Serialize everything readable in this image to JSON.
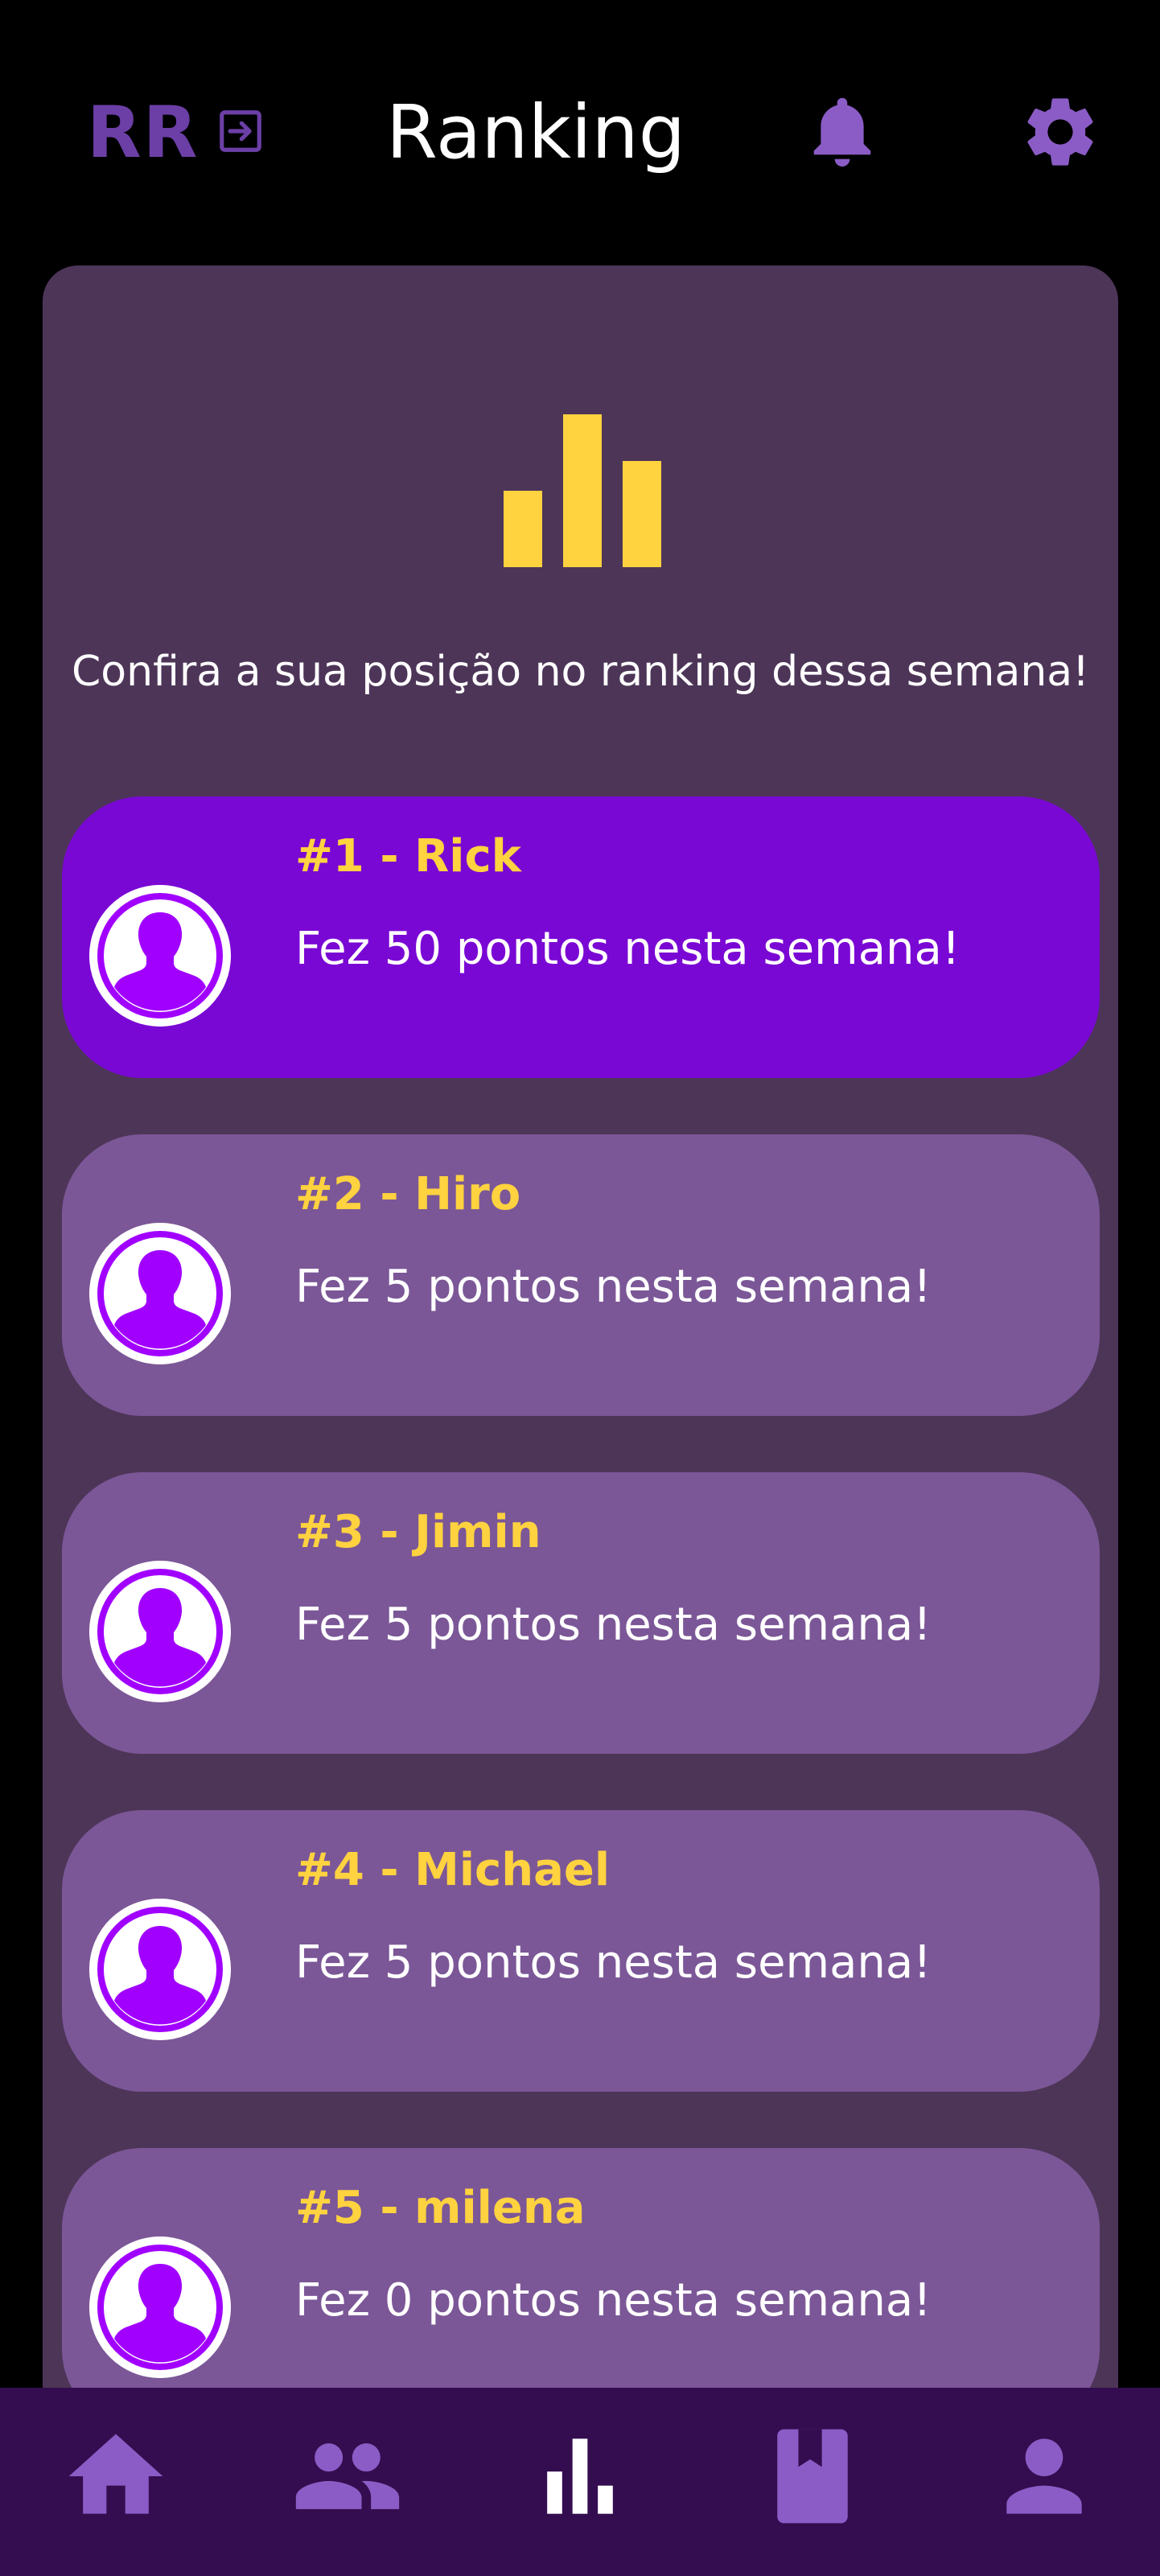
{
  "header": {
    "logo_text": "RR",
    "title": "Ranking",
    "logout_icon": "logout-icon",
    "notification_icon": "bell-icon",
    "settings_icon": "gear-icon"
  },
  "colors": {
    "background": "#000000",
    "panel": "#4d3558",
    "card": "#7b5797",
    "card_highlight": "#7a08d4",
    "accent_yellow": "#ffd23f",
    "accent_purple": "#8b5cc6",
    "nav_background": "#330d4f",
    "avatar_purple": "#a100ff"
  },
  "main": {
    "header_icon": "bar-chart-icon",
    "subtitle": "Confira a sua posição no ranking dessa semana!",
    "ranking": [
      {
        "title": "#1 - Rick",
        "points_text": "Fez 50 pontos nesta semana!",
        "highlighted": true
      },
      {
        "title": "#2 - Hiro",
        "points_text": "Fez 5 pontos nesta semana!",
        "highlighted": false
      },
      {
        "title": "#3 - Jimin",
        "points_text": "Fez 5 pontos nesta semana!",
        "highlighted": false
      },
      {
        "title": "#4 - Michael",
        "points_text": "Fez 5 pontos nesta semana!",
        "highlighted": false
      },
      {
        "title": "#5 - milena",
        "points_text": "Fez 0 pontos nesta semana!",
        "highlighted": false
      }
    ]
  },
  "bottom_nav": {
    "items": [
      {
        "icon": "home-icon",
        "active": false
      },
      {
        "icon": "group-icon",
        "active": false
      },
      {
        "icon": "ranking-icon",
        "active": true
      },
      {
        "icon": "book-icon",
        "active": false
      },
      {
        "icon": "profile-icon",
        "active": false
      }
    ]
  }
}
